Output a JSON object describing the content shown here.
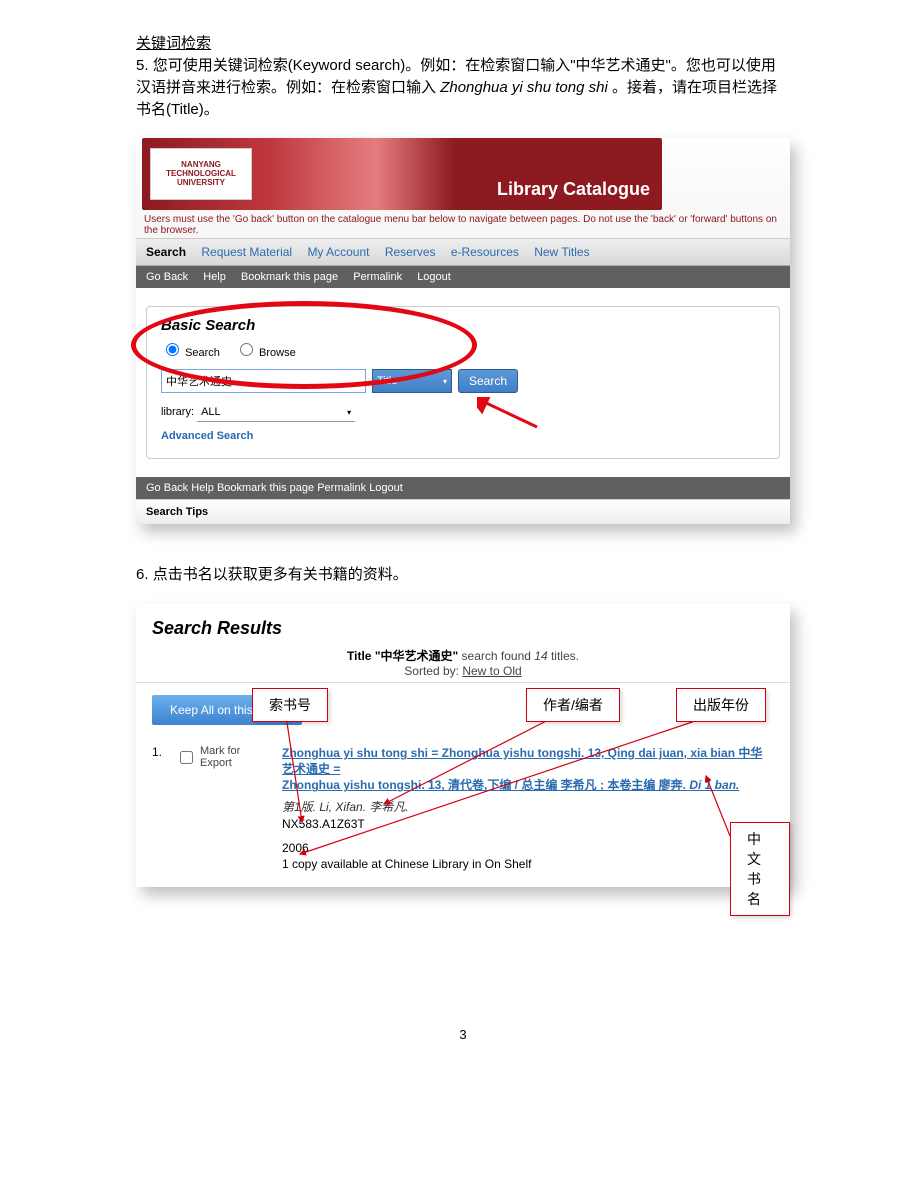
{
  "section_title": "关键词检索",
  "para5": {
    "num": "5.",
    "text_a": "您可使用关键词检索(Keyword search)。例如：在检索窗口输入\"中华艺术通史\"。您也可以使用汉语拼音来进行检索。例如：在检索窗口输入",
    "pinyin": "Zhonghua yi shu tong shi",
    "text_b": "。接着，请在项目栏选择书名(Title)。"
  },
  "catalogue": {
    "university": "NANYANG TECHNOLOGICAL UNIVERSITY",
    "header_text": "Library Catalogue",
    "notice": "Users must use the 'Go back' button on the catalogue menu bar below to navigate between pages.  Do not use the 'back' or 'forward' buttons on the browser.",
    "tabs": [
      "Search",
      "Request Material",
      "My Account",
      "Reserves",
      "e-Resources",
      "New Titles"
    ],
    "subnav": [
      "Go Back",
      "Help",
      "Bookmark this page",
      "Permalink",
      "Logout"
    ],
    "basic_search_title": "Basic Search",
    "radio_search": "Search",
    "radio_browse": "Browse",
    "query_value": "中华艺术通史",
    "field": "Title",
    "search_button": "Search",
    "library_label": "library:",
    "library_value": "ALL",
    "adv_search": "Advanced Search",
    "search_tips": "Search Tips"
  },
  "para6": {
    "num": "6.",
    "text": "点击书名以获取更多有关书籍的资料。"
  },
  "results": {
    "heading": "Search Results",
    "summary_prefix": "Title ",
    "summary_term": "\"中华艺术通史\"",
    "summary_mid": " search found ",
    "summary_count": "14",
    "summary_suffix": " titles.",
    "sorted_by_label": "Sorted by: ",
    "sorted_by_value": "New to Old",
    "keep_all": "Keep All on this Page",
    "item": {
      "num": "1.",
      "mark": "Mark for Export",
      "title_line1": "Zhonghua yi shu tong shi = Zhonghua yishu tongshi. 13, Qing dai juan, xia bian 中华艺术通史 =",
      "title_line2_a": "Zhonghua yishu tongshi. 13, 清代卷,下编 / 总主编 李希凡 ; 本卷主编 廖奔. ",
      "title_line2_b": "Di 1 ban.",
      "author_line": "第1版. Li, Xifan. 李希凡.",
      "call_number": "NX583.A1Z63T",
      "year": "2006",
      "availability": "1 copy available at Chinese Library in On Shelf"
    }
  },
  "annotations": {
    "call_number": "索书号",
    "author": "作者/编者",
    "year": "出版年份",
    "cn_title": "中文书名"
  },
  "page_number": "3"
}
